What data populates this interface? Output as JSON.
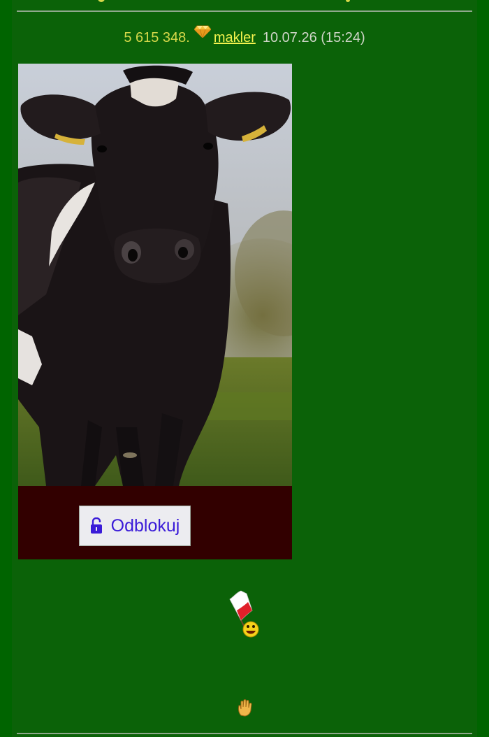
{
  "post": {
    "number": "5 615 348.",
    "author": "makler",
    "timestamp": "10.07.26 (15:24)"
  },
  "image": {
    "unlock_label": "Odblokuj"
  },
  "icons": {
    "rank": "gem-icon",
    "lock": "unlock-icon",
    "emoticon_flag": "poland-flag-smiley-icon",
    "emoticon_hand": "waving-hand-icon"
  },
  "colors": {
    "background": "#0b6208",
    "meta_text": "#d6d84a",
    "username": "#f2f24e",
    "date_text": "#cfd5c8",
    "lock_bar": "#320000",
    "button_text": "#3a1bd8"
  }
}
